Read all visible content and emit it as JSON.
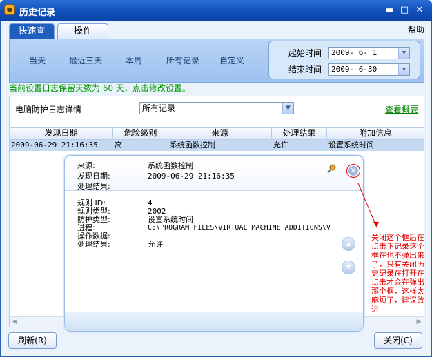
{
  "window": {
    "title": "历史记录",
    "help": "帮助"
  },
  "tabs": [
    {
      "label": "快速查看"
    },
    {
      "label": "操作"
    }
  ],
  "quick": {
    "options": [
      "当天",
      "最近三天",
      "本周",
      "所有记录",
      "自定义"
    ],
    "start_label": "起始时间",
    "start_value": "2009- 6- 1",
    "end_label": "结束时间",
    "end_value": "2009- 6-30"
  },
  "notice": "当前设置日志保留天数为 60 天，点击修改设置。",
  "section": {
    "label": "电脑防护日志详情",
    "filter_value": "所有记录",
    "overview_link": "查看概要"
  },
  "table": {
    "headers": [
      "发现日期",
      "危险级别",
      "来源",
      "处理结果",
      "附加信息"
    ],
    "rows": [
      [
        "2009-06-29 21:16:35",
        "高",
        "系统函数控制",
        "允许",
        "设置系统时间"
      ]
    ]
  },
  "popup": {
    "source_key": "来源:",
    "source_val": "系统函数控制",
    "date_key": "发现日期:",
    "date_val": "2009-06-29 21:16:35",
    "result_key": "处理结果:",
    "details": [
      {
        "k": "规则 ID:",
        "v": "4"
      },
      {
        "k": "规则类型:",
        "v": "2002"
      },
      {
        "k": "防护类型:",
        "v": "设置系统时间"
      },
      {
        "k": "进程:",
        "v": "C:\\PROGRAM FILES\\VIRTUAL MACHINE ADDITIONS\\V"
      },
      {
        "k": "操作数据:",
        "v": ""
      },
      {
        "k": "处理结果:",
        "v": "允许"
      }
    ]
  },
  "annotation": "关闭这个框后在点击下记录这个框在也不弹出来了，只有关闭历史纪录在打开在点击才会在弹出那个框，这样太麻烦了，建议改进",
  "buttons": {
    "refresh": "刷新(R)",
    "close": "关闭(C)"
  },
  "colors": {
    "titlebar": "#0f4fb8",
    "notice": "#009900",
    "annotation": "#e00000",
    "selected_row": "#c5d9f3"
  }
}
